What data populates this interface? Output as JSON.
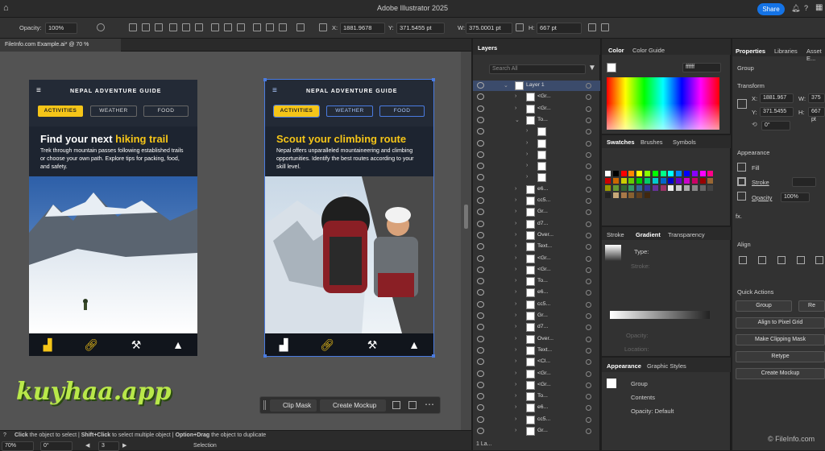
{
  "app": {
    "title": "Adobe Illustrator 2025",
    "share_label": "Share",
    "document_tab": "FileInfo.com Example.ai* @ 70 % (RGB/Preview)"
  },
  "control_bar": {
    "opacity_label": "Opacity:",
    "opacity_value": "100%",
    "x_label": "X:",
    "x_value": "1881.9678",
    "y_label": "Y:",
    "y_value": "371.5455 pt",
    "w_label": "W:",
    "w_value": "375.0001 pt",
    "h_label": "H:",
    "h_value": "667 pt"
  },
  "artboard_left": {
    "nav_title": "NEPAL ADVENTURE GUIDE",
    "tabs": [
      "ACTIVITIES",
      "WEATHER",
      "FOOD"
    ],
    "headline_part1": "Find your next ",
    "headline_part2": "hiking trail",
    "paragraph": "Trek through mountain passes following established trails or choose your own path. Explore tips for packing, food, and safety."
  },
  "artboard_right": {
    "nav_title": "NEPAL ADVENTURE GUIDE",
    "tabs": [
      "ACTIVITIES",
      "WEATHER",
      "FOOD"
    ],
    "headline_part1": "Scout your ",
    "headline_part2": "climbing route",
    "paragraph": "Nepal offers unparalleled mountaineering and climbing opportunities. Identify the best routes according to your skill level."
  },
  "context_bar": {
    "clip_mask": "Clip Mask",
    "create_mockup": "Create Mockup"
  },
  "status_bar": {
    "zoom": "70%",
    "rotation": "0°",
    "artboard_num": "3",
    "tool": "Selection",
    "hint_click": "Click",
    "hint1": " the object to select  |  ",
    "hint_shift": "Shift+Click",
    "hint2": " to select multiple object  |  ",
    "hint_option": "Option+Drag",
    "hint3": " the object to duplicate",
    "watermark": "kuyhaa.app",
    "fileinfo": "© FileInfo.com"
  },
  "layers_panel": {
    "tab": "Layers",
    "search_placeholder": "Search All",
    "rows": [
      "Layer 1",
      "<Gr...",
      "<Gr...",
      "To...",
      "",
      "",
      "",
      "",
      "",
      "e6...",
      "cc5...",
      "Gr...",
      "d7...",
      "Over...",
      "Text...",
      "<Gr...",
      "<Gr...",
      "To...",
      "e6...",
      "cc5...",
      "Gr...",
      "d7...",
      "Over...",
      "Text...",
      "<Cl...",
      "<Gr...",
      "<Gr...",
      "To...",
      "e6...",
      "cc5...",
      "Gr..."
    ],
    "footer": "1 La..."
  },
  "color_panel": {
    "tabs": [
      "Color",
      "Color Guide"
    ],
    "hex": "ffffff"
  },
  "swatches_panel": {
    "tabs": [
      "Swatches",
      "Brushes",
      "Symbols"
    ],
    "colors": [
      "#ffffff",
      "#000000",
      "#ff0000",
      "#ff8800",
      "#ffff00",
      "#88ff00",
      "#00ff00",
      "#00ff88",
      "#00ffff",
      "#0088ff",
      "#0000ff",
      "#8800ff",
      "#ff00ff",
      "#ff0088",
      "#cc0000",
      "#cc6600",
      "#cccc00",
      "#66cc00",
      "#00cc00",
      "#00cc66",
      "#00cccc",
      "#0066cc",
      "#0000cc",
      "#6600cc",
      "#cc00cc",
      "#cc0066",
      "#990000",
      "#996633",
      "#999900",
      "#669933",
      "#336633",
      "#339966",
      "#336699",
      "#333399",
      "#663399",
      "#993366",
      "#eeeeee",
      "#cccccc",
      "#aaaaaa",
      "#888888",
      "#666666",
      "#444444",
      "#222222",
      "#c8a878",
      "#a87848",
      "#886030",
      "#604020",
      "#402810"
    ]
  },
  "gradient_panel": {
    "tabs": [
      "Stroke",
      "Gradient",
      "Transparency"
    ],
    "type_label": "Type:",
    "stroke_label": "Stroke:",
    "opacity_label": "Opacity:",
    "location_label": "Location:"
  },
  "appearance_panel": {
    "tabs": [
      "Appearance",
      "Graphic Styles"
    ],
    "group": "Group",
    "contents": "Contents",
    "opacity": "Opacity: Default"
  },
  "properties_panel": {
    "tabs": [
      "Properties",
      "Libraries",
      "Asset E..."
    ],
    "group": "Group",
    "transform": "Transform",
    "x_label": "X:",
    "x_value": "1881.967",
    "y_label": "Y:",
    "y_value": "371.5455",
    "w_label": "W:",
    "w_value": "375",
    "h_label": "H:",
    "h_value": "667 pt",
    "angle": "0°",
    "appearance": "Appearance",
    "fill": "Fill",
    "stroke": "Stroke",
    "opacity": "Opacity",
    "opacity_value": "100%",
    "fx": "fx.",
    "align": "Align",
    "quick_actions": "Quick Actions",
    "qa_group": "Group",
    "qa_re": "Re",
    "align_pixel": "Align to Pixel Grid",
    "make_clip": "Make Clipping Mask",
    "retype": "Retype",
    "create_mockup": "Create Mockup"
  }
}
